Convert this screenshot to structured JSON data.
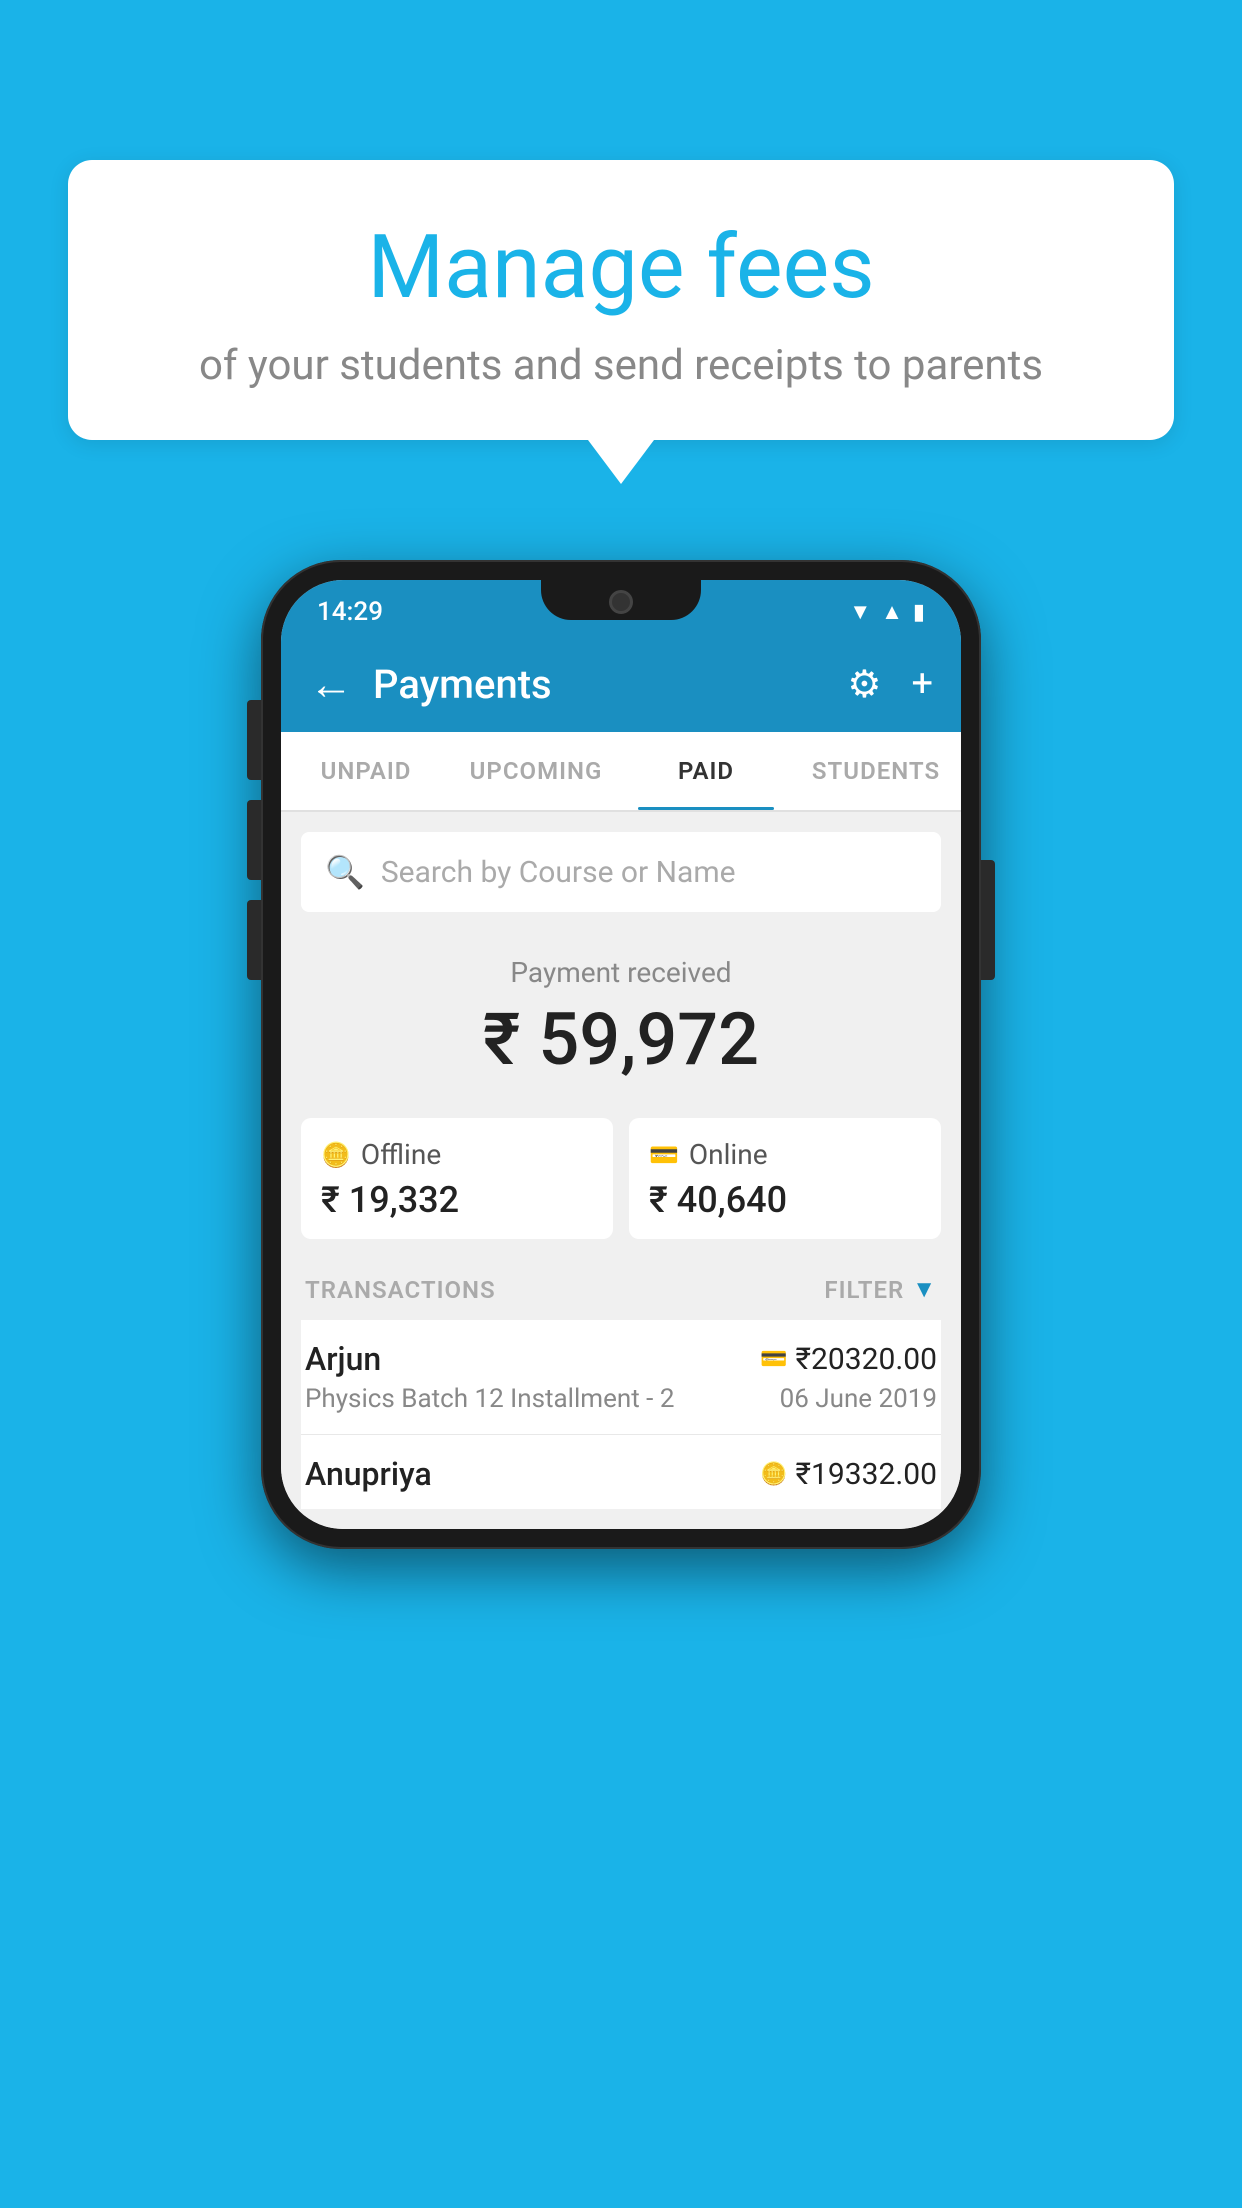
{
  "background_color": "#1ab3e8",
  "bubble": {
    "title": "Manage fees",
    "subtitle": "of your students and send receipts to parents"
  },
  "status_bar": {
    "time": "14:29"
  },
  "app_bar": {
    "title": "Payments",
    "back_label": "←",
    "gear_label": "⚙",
    "plus_label": "+"
  },
  "tabs": [
    {
      "label": "UNPAID",
      "active": false
    },
    {
      "label": "UPCOMING",
      "active": false
    },
    {
      "label": "PAID",
      "active": true
    },
    {
      "label": "STUDENTS",
      "active": false
    }
  ],
  "search": {
    "placeholder": "Search by Course or Name"
  },
  "payment_received": {
    "label": "Payment received",
    "amount": "₹ 59,972"
  },
  "payment_cards": [
    {
      "type": "Offline",
      "amount": "₹ 19,332",
      "icon": "💳"
    },
    {
      "type": "Online",
      "amount": "₹ 40,640",
      "icon": "💳"
    }
  ],
  "transactions_header": {
    "label": "TRANSACTIONS",
    "filter_label": "FILTER"
  },
  "transactions": [
    {
      "name": "Arjun",
      "course": "Physics Batch 12 Installment - 2",
      "amount": "₹20320.00",
      "date": "06 June 2019",
      "type": "online"
    },
    {
      "name": "Anupriya",
      "course": "",
      "amount": "₹19332.00",
      "date": "",
      "type": "offline"
    }
  ]
}
